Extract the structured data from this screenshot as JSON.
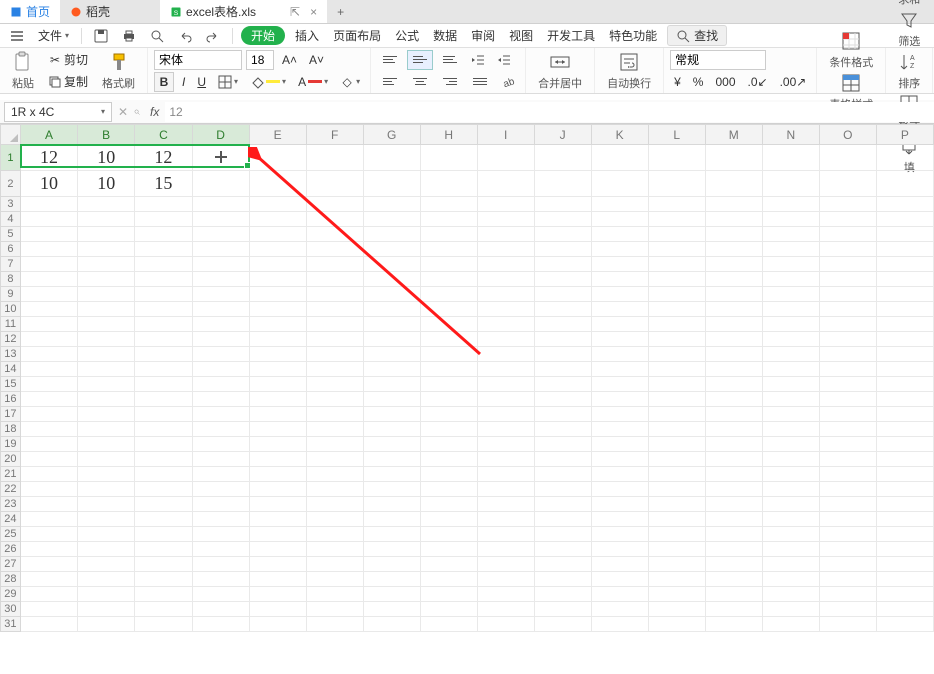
{
  "tabs": {
    "home": "首页",
    "doc": "稻壳",
    "xls": "excel表格.xls",
    "close": "×",
    "plus": "+"
  },
  "menu": {
    "file": "文件",
    "start": "开始",
    "insert": "插入",
    "layout": "页面布局",
    "formula": "公式",
    "data": "数据",
    "review": "审阅",
    "view": "视图",
    "dev": "开发工具",
    "special": "特色功能",
    "search": "查找"
  },
  "ribbon": {
    "paste": "粘贴",
    "cut": "剪切",
    "copy": "复制",
    "format_painter": "格式刷",
    "font_name": "宋体",
    "font_size": "18",
    "bold": "B",
    "italic": "I",
    "underline": "U",
    "number_format": "常规",
    "currency": "¥",
    "percent": "%",
    "comma_style": "000",
    "dec_inc": ".0←",
    "dec_dec": ".00→",
    "merge": "合并居中",
    "wrap": "自动换行",
    "cond_format": "条件格式",
    "table_style": "表格样式",
    "sum": "求和",
    "filter": "筛选",
    "sort": "排序",
    "cell_format": "格式",
    "fill": "填"
  },
  "name_box": "1R x 4C",
  "fx_label": "fx",
  "formula_value": "12",
  "columns": [
    "A",
    "B",
    "C",
    "D",
    "E",
    "F",
    "G",
    "H",
    "I",
    "J",
    "K",
    "L",
    "M",
    "N",
    "O",
    "P"
  ],
  "row_count": 31,
  "selection": {
    "row": 1,
    "col_start": 1,
    "col_end": 4
  },
  "cells": {
    "A1": "12",
    "B1": "10",
    "C1": "12",
    "A2": "10",
    "B2": "10",
    "C2": "15"
  },
  "chart_data": {
    "type": "table",
    "rows": [
      [
        12,
        10,
        12,
        null
      ],
      [
        10,
        10,
        15,
        null
      ]
    ],
    "columns": [
      "A",
      "B",
      "C",
      "D"
    ]
  }
}
